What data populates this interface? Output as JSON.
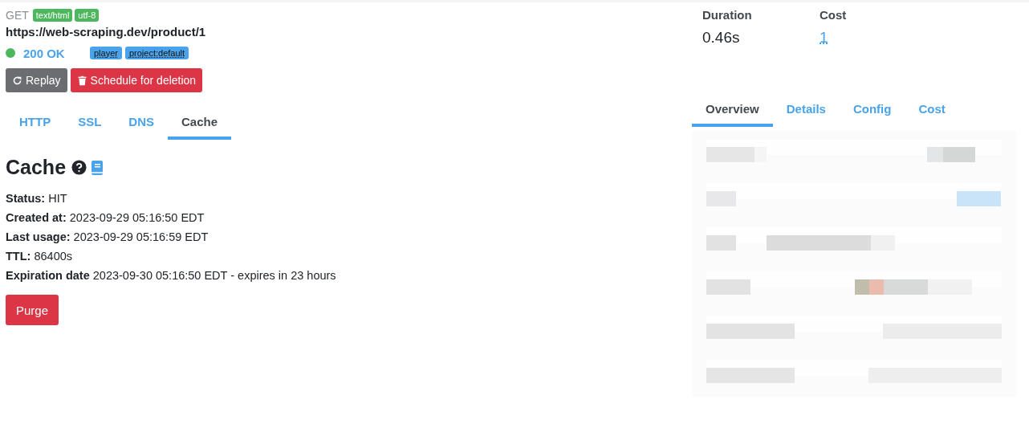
{
  "request": {
    "method": "GET",
    "badges": [
      "text/html",
      "utf-8"
    ],
    "url": "https://web-scraping.dev/product/1"
  },
  "status": {
    "text": "200 OK",
    "color": "#4cb75c",
    "tags": [
      "player",
      "project:default"
    ]
  },
  "actions": [
    {
      "kind": "secondary",
      "label": "Replay"
    },
    {
      "kind": "danger",
      "label": "Schedule for deletion"
    }
  ],
  "stats": [
    {
      "label": "Duration",
      "value": "0.46s",
      "kind": "plain"
    },
    {
      "label": "Cost",
      "value": "1",
      "kind": "link"
    }
  ],
  "tabs": [
    {
      "label": "HTTP",
      "selected": false
    },
    {
      "label": "SSL",
      "selected": false
    },
    {
      "label": "DNS",
      "selected": false
    },
    {
      "label": "Cache",
      "selected": true
    }
  ],
  "side_tabs": [
    {
      "label": "Overview",
      "selected": true
    },
    {
      "label": "Details",
      "selected": false
    },
    {
      "label": "Config",
      "selected": false
    },
    {
      "label": "Cost",
      "selected": false
    }
  ],
  "cache": {
    "title": "Cache",
    "fields": [
      {
        "label": "Status:",
        "value": "HIT"
      },
      {
        "label": "Created at:",
        "value": "2023-09-29 05:16:50 EDT"
      },
      {
        "label": "Last usage:",
        "value": "2023-09-29 05:16:59 EDT"
      },
      {
        "label": "TTL:",
        "value": "86400s"
      },
      {
        "label": "Expiration date",
        "value": "2023-09-30 05:16:50 EDT - expires in 23 hours"
      }
    ],
    "button": "Purge"
  }
}
